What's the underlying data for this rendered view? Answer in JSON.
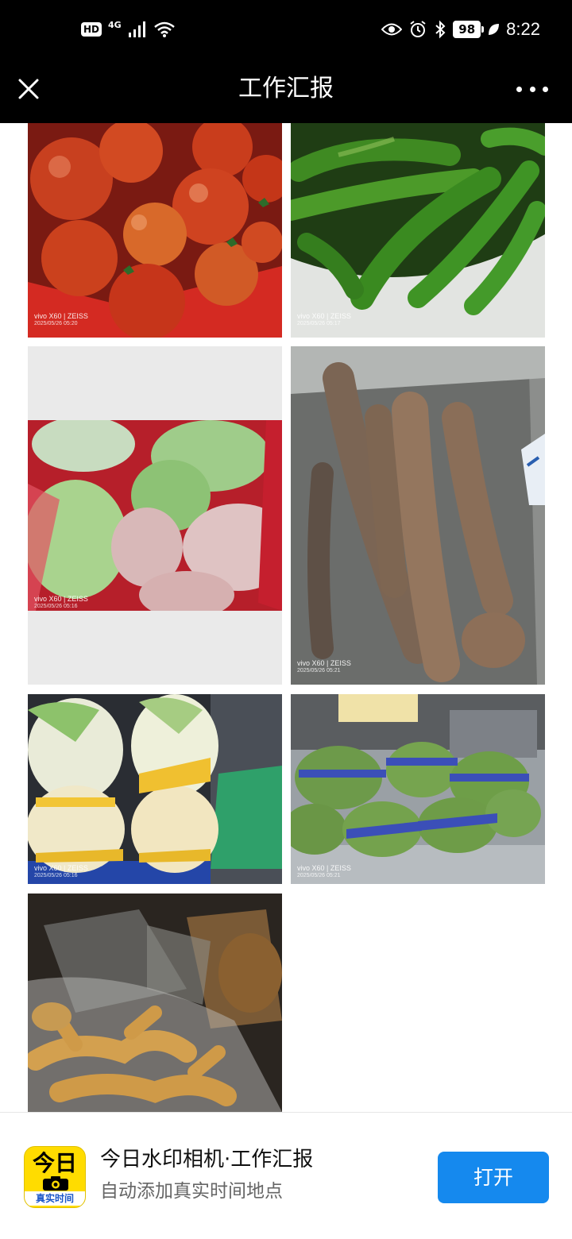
{
  "status_bar": {
    "hd": "HD",
    "network": "4G",
    "battery": "98",
    "time": "8:22",
    "icons": [
      "signal-icon",
      "wifi-icon",
      "eye-icon",
      "alarm-icon",
      "bluetooth-icon",
      "battery-icon",
      "leaf-icon"
    ]
  },
  "header": {
    "title": "工作汇报",
    "close_icon": "close-icon",
    "more_icon": "more-icon"
  },
  "photos": [
    {
      "subject": "tomatoes",
      "watermark": "vivo X60 | ZEISS",
      "timestamp": "2025/05/26 05:20"
    },
    {
      "subject": "green peppers",
      "watermark": "vivo X60 | ZEISS",
      "timestamp": "2025/05/26 05:17"
    },
    {
      "subject": "cabbage",
      "watermark": "vivo X60 | ZEISS",
      "timestamp": "2025/05/26 05:16"
    },
    {
      "subject": "yam",
      "watermark": "vivo X60 | ZEISS",
      "timestamp": "2025/05/26 05:21"
    },
    {
      "subject": "napa cabbage",
      "watermark": "vivo X60 | ZEISS",
      "timestamp": "2025/05/26 05:16"
    },
    {
      "subject": "edamame",
      "watermark": "vivo X60 | ZEISS",
      "timestamp": "2025/05/26 05:21"
    },
    {
      "subject": "ginger",
      "watermark": "",
      "timestamp": ""
    }
  ],
  "banner": {
    "icon_big": "今日",
    "icon_small": "真实时间",
    "app_name": "今日水印相机·工作汇报",
    "app_desc": "自动添加真实时间地点",
    "open_label": "打开",
    "accent": "#1589ee"
  }
}
